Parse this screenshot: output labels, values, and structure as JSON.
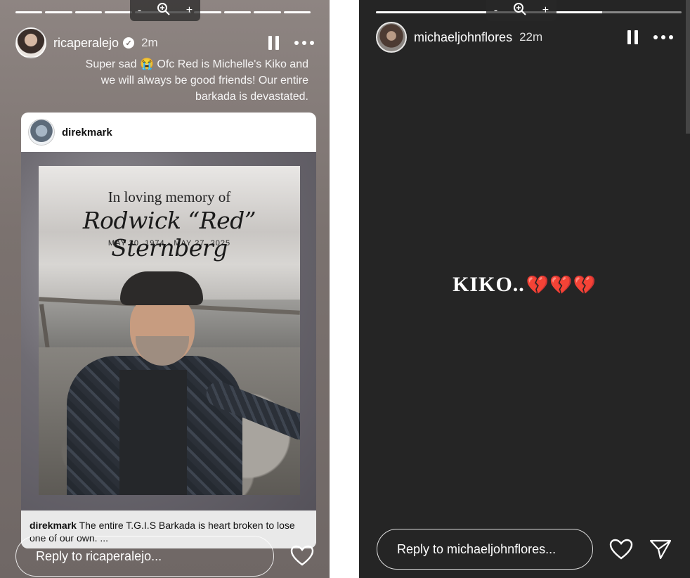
{
  "left_story": {
    "username": "ricaperalejo",
    "time": "2m",
    "caption": "Super sad 😭 Ofc Red is Michelle's Kiko and we will always be good friends! Our entire barkada is devastated.",
    "shared_post": {
      "username": "direkmark",
      "memorial": {
        "line1": "In loving memory of",
        "name": "Rodwick “Red” Sternberg",
        "dates": "MAY 30, 1974 - MAY 27, 2025"
      },
      "caption_user": "direkmark",
      "caption_text": "The entire T.G.I.S Barkada is heart broken to lose one of our own. ..."
    },
    "reply_placeholder": "Reply to ricaperalejo..."
  },
  "right_story": {
    "username": "michaeljohnflores",
    "time": "22m",
    "text": "KIKO..",
    "hearts": "💔💔💔",
    "reply_placeholder": "Reply to michaeljohnflores..."
  },
  "zoom": {
    "minus": "-",
    "plus": "+"
  }
}
